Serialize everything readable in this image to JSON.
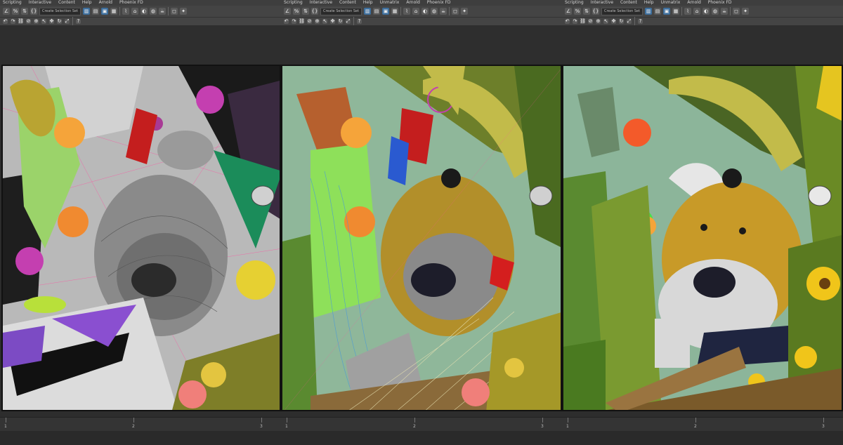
{
  "windows": [
    {
      "menu": [
        "Scripting",
        "Interactive",
        "Content",
        "Help",
        "Arnold",
        "Phoenix FD"
      ],
      "selection_set": "Create Selection Set",
      "timeline_ticks": [
        "1",
        "2",
        "3"
      ],
      "mode": "grey-wireframe"
    },
    {
      "menu": [
        "Scripting",
        "Interactive",
        "Content",
        "Help",
        "Unmatrix",
        "Arnold",
        "Phoenix FD"
      ],
      "selection_set": "Create Selection Set",
      "timeline_ticks": [
        "1",
        "2",
        "3"
      ],
      "mode": "shaded-wireframe"
    },
    {
      "menu": [
        "Scripting",
        "Interactive",
        "Content",
        "Help",
        "Unmatrix",
        "Arnold",
        "Phoenix FD"
      ],
      "selection_set": "Create Selection Set",
      "timeline_ticks": [
        "1",
        "2",
        "3"
      ],
      "mode": "rendered"
    }
  ],
  "toolbar_icons": [
    "undo-icon",
    "redo-icon",
    "link-icon",
    "unlink-icon",
    "bind-icon",
    "select-icon",
    "select-region-icon",
    "move-icon",
    "rotate-icon",
    "scale-icon",
    "snap-icon",
    "angle-snap-icon",
    "percent-snap-icon",
    "mirror-icon",
    "align-icon",
    "layer-icon",
    "curve-editor-icon",
    "material-editor-icon",
    "render-setup-icon",
    "render-icon",
    "help-icon"
  ],
  "colors": {
    "ui_bg": "#444444",
    "viewport_border": "#111111",
    "accent_blue": "#3d6f9e",
    "viewport1_bg": "#b9b9b9",
    "viewport2_bg": "#8fb79a",
    "viewport3_bg": "#8cb59a"
  }
}
